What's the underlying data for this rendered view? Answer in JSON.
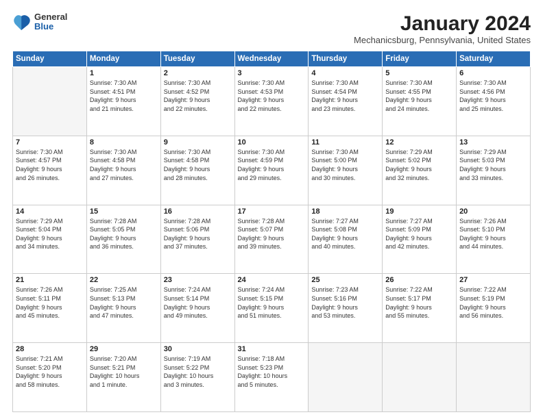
{
  "logo": {
    "general": "General",
    "blue": "Blue"
  },
  "title": "January 2024",
  "subtitle": "Mechanicsburg, Pennsylvania, United States",
  "days_of_week": [
    "Sunday",
    "Monday",
    "Tuesday",
    "Wednesday",
    "Thursday",
    "Friday",
    "Saturday"
  ],
  "weeks": [
    [
      {
        "num": "",
        "info": ""
      },
      {
        "num": "1",
        "info": "Sunrise: 7:30 AM\nSunset: 4:51 PM\nDaylight: 9 hours\nand 21 minutes."
      },
      {
        "num": "2",
        "info": "Sunrise: 7:30 AM\nSunset: 4:52 PM\nDaylight: 9 hours\nand 22 minutes."
      },
      {
        "num": "3",
        "info": "Sunrise: 7:30 AM\nSunset: 4:53 PM\nDaylight: 9 hours\nand 22 minutes."
      },
      {
        "num": "4",
        "info": "Sunrise: 7:30 AM\nSunset: 4:54 PM\nDaylight: 9 hours\nand 23 minutes."
      },
      {
        "num": "5",
        "info": "Sunrise: 7:30 AM\nSunset: 4:55 PM\nDaylight: 9 hours\nand 24 minutes."
      },
      {
        "num": "6",
        "info": "Sunrise: 7:30 AM\nSunset: 4:56 PM\nDaylight: 9 hours\nand 25 minutes."
      }
    ],
    [
      {
        "num": "7",
        "info": "Sunrise: 7:30 AM\nSunset: 4:57 PM\nDaylight: 9 hours\nand 26 minutes."
      },
      {
        "num": "8",
        "info": "Sunrise: 7:30 AM\nSunset: 4:58 PM\nDaylight: 9 hours\nand 27 minutes."
      },
      {
        "num": "9",
        "info": "Sunrise: 7:30 AM\nSunset: 4:58 PM\nDaylight: 9 hours\nand 28 minutes."
      },
      {
        "num": "10",
        "info": "Sunrise: 7:30 AM\nSunset: 4:59 PM\nDaylight: 9 hours\nand 29 minutes."
      },
      {
        "num": "11",
        "info": "Sunrise: 7:30 AM\nSunset: 5:00 PM\nDaylight: 9 hours\nand 30 minutes."
      },
      {
        "num": "12",
        "info": "Sunrise: 7:29 AM\nSunset: 5:02 PM\nDaylight: 9 hours\nand 32 minutes."
      },
      {
        "num": "13",
        "info": "Sunrise: 7:29 AM\nSunset: 5:03 PM\nDaylight: 9 hours\nand 33 minutes."
      }
    ],
    [
      {
        "num": "14",
        "info": "Sunrise: 7:29 AM\nSunset: 5:04 PM\nDaylight: 9 hours\nand 34 minutes."
      },
      {
        "num": "15",
        "info": "Sunrise: 7:28 AM\nSunset: 5:05 PM\nDaylight: 9 hours\nand 36 minutes."
      },
      {
        "num": "16",
        "info": "Sunrise: 7:28 AM\nSunset: 5:06 PM\nDaylight: 9 hours\nand 37 minutes."
      },
      {
        "num": "17",
        "info": "Sunrise: 7:28 AM\nSunset: 5:07 PM\nDaylight: 9 hours\nand 39 minutes."
      },
      {
        "num": "18",
        "info": "Sunrise: 7:27 AM\nSunset: 5:08 PM\nDaylight: 9 hours\nand 40 minutes."
      },
      {
        "num": "19",
        "info": "Sunrise: 7:27 AM\nSunset: 5:09 PM\nDaylight: 9 hours\nand 42 minutes."
      },
      {
        "num": "20",
        "info": "Sunrise: 7:26 AM\nSunset: 5:10 PM\nDaylight: 9 hours\nand 44 minutes."
      }
    ],
    [
      {
        "num": "21",
        "info": "Sunrise: 7:26 AM\nSunset: 5:11 PM\nDaylight: 9 hours\nand 45 minutes."
      },
      {
        "num": "22",
        "info": "Sunrise: 7:25 AM\nSunset: 5:13 PM\nDaylight: 9 hours\nand 47 minutes."
      },
      {
        "num": "23",
        "info": "Sunrise: 7:24 AM\nSunset: 5:14 PM\nDaylight: 9 hours\nand 49 minutes."
      },
      {
        "num": "24",
        "info": "Sunrise: 7:24 AM\nSunset: 5:15 PM\nDaylight: 9 hours\nand 51 minutes."
      },
      {
        "num": "25",
        "info": "Sunrise: 7:23 AM\nSunset: 5:16 PM\nDaylight: 9 hours\nand 53 minutes."
      },
      {
        "num": "26",
        "info": "Sunrise: 7:22 AM\nSunset: 5:17 PM\nDaylight: 9 hours\nand 55 minutes."
      },
      {
        "num": "27",
        "info": "Sunrise: 7:22 AM\nSunset: 5:19 PM\nDaylight: 9 hours\nand 56 minutes."
      }
    ],
    [
      {
        "num": "28",
        "info": "Sunrise: 7:21 AM\nSunset: 5:20 PM\nDaylight: 9 hours\nand 58 minutes."
      },
      {
        "num": "29",
        "info": "Sunrise: 7:20 AM\nSunset: 5:21 PM\nDaylight: 10 hours\nand 1 minute."
      },
      {
        "num": "30",
        "info": "Sunrise: 7:19 AM\nSunset: 5:22 PM\nDaylight: 10 hours\nand 3 minutes."
      },
      {
        "num": "31",
        "info": "Sunrise: 7:18 AM\nSunset: 5:23 PM\nDaylight: 10 hours\nand 5 minutes."
      },
      {
        "num": "",
        "info": ""
      },
      {
        "num": "",
        "info": ""
      },
      {
        "num": "",
        "info": ""
      }
    ]
  ]
}
